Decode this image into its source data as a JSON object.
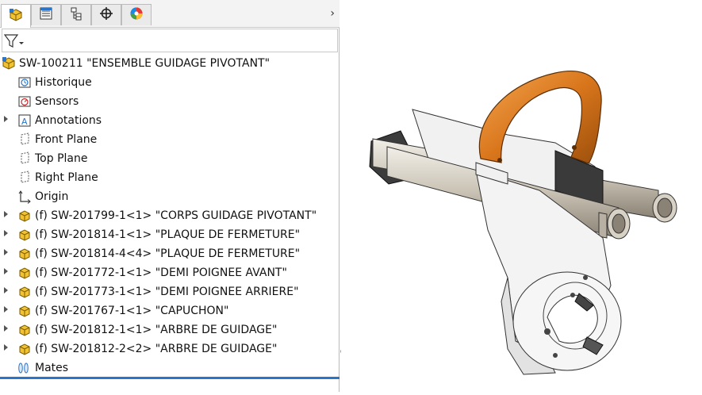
{
  "tabs": [
    {
      "name": "feature-manager-icon"
    },
    {
      "name": "property-manager-icon"
    },
    {
      "name": "configuration-manager-icon"
    },
    {
      "name": "dimxpert-manager-icon"
    },
    {
      "name": "display-manager-icon"
    }
  ],
  "tabs_more": "›",
  "filter": {
    "icon": "filter-icon"
  },
  "root": {
    "label": "SW-100211 \"ENSEMBLE GUIDAGE PIVOTANT\""
  },
  "items": [
    {
      "label": "Historique",
      "icon": "history-icon"
    },
    {
      "label": "Sensors",
      "icon": "sensors-icon"
    },
    {
      "label": "Annotations",
      "icon": "annotations-icon",
      "expandable": true
    },
    {
      "label": "Front Plane",
      "icon": "plane-icon"
    },
    {
      "label": "Top Plane",
      "icon": "plane-icon"
    },
    {
      "label": "Right Plane",
      "icon": "plane-icon"
    },
    {
      "label": "Origin",
      "icon": "origin-icon"
    },
    {
      "label": "(f) SW-201799-1<1> \"CORPS GUIDAGE PIVOTANT\"",
      "icon": "part-icon",
      "expandable": true
    },
    {
      "label": "(f) SW-201814-1<1> \"PLAQUE DE FERMETURE\"",
      "icon": "part-icon",
      "expandable": true
    },
    {
      "label": "(f) SW-201814-4<4> \"PLAQUE DE FERMETURE\"",
      "icon": "part-icon",
      "expandable": true
    },
    {
      "label": "(f) SW-201772-1<1> \"DEMI POIGNEE AVANT\"",
      "icon": "part-icon",
      "expandable": true
    },
    {
      "label": "(f) SW-201773-1<1> \"DEMI POIGNEE ARRIERE\"",
      "icon": "part-icon",
      "expandable": true
    },
    {
      "label": "(f) SW-201767-1<1> \"CAPUCHON\"",
      "icon": "part-icon",
      "expandable": true
    },
    {
      "label": "(f) SW-201812-1<1> \"ARBRE DE GUIDAGE\"",
      "icon": "part-icon",
      "expandable": true
    },
    {
      "label": "(f) SW-201812-2<2> \"ARBRE DE GUIDAGE\"",
      "icon": "part-icon",
      "expandable": true
    },
    {
      "label": "Mates",
      "icon": "mates-icon"
    }
  ],
  "colors": {
    "accent": "#2a74c9",
    "part": "#e6b422",
    "handle": "#e0821e"
  }
}
